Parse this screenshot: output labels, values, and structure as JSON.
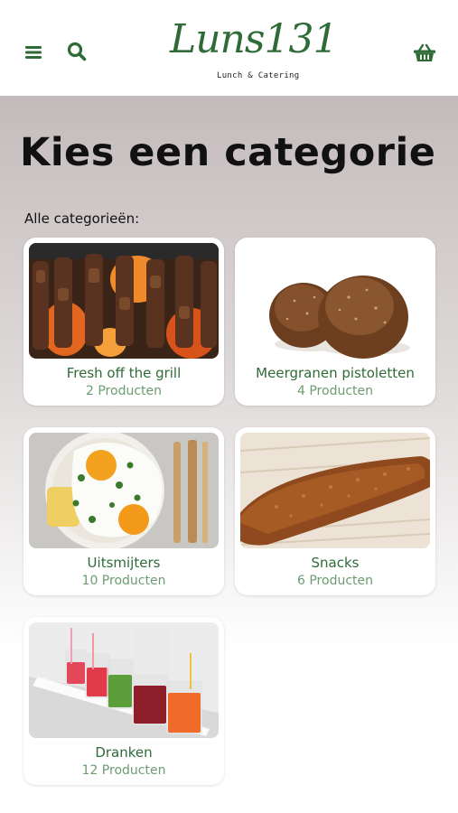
{
  "header": {
    "logo_text": "Luns131",
    "logo_subtitle": "Lunch & Catering",
    "menu_icon": "hamburger-menu-icon",
    "search_icon": "search-icon",
    "cart_icon": "basket-icon",
    "accent_color": "#2e6b36"
  },
  "page": {
    "title": "Kies een categorie",
    "subheading": "Alle categorieën:"
  },
  "categories": [
    {
      "name": "Fresh off the grill",
      "count": "2 Producten",
      "image": "grilled-skewers-photo"
    },
    {
      "name": "Meergranen pistoletten",
      "count": "4 Producten",
      "image": "multigrain-rolls-photo"
    },
    {
      "name": "Uitsmijters",
      "count": "10 Producten",
      "image": "fried-eggs-photo"
    },
    {
      "name": "Snacks",
      "count": "6 Producten",
      "image": "croquette-photo"
    },
    {
      "name": "Dranken",
      "count": "12 Producten",
      "image": "juice-glasses-photo"
    }
  ]
}
